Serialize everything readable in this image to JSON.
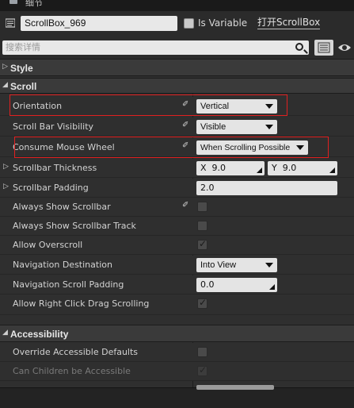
{
  "tab": {
    "title": "细节"
  },
  "header": {
    "name_value": "ScrollBox_969",
    "is_variable_label": "Is Variable",
    "open_label": "打开ScrollBox"
  },
  "search": {
    "placeholder": "搜索详情"
  },
  "categories": {
    "style": "Style",
    "scroll": "Scroll",
    "accessibility": "Accessibility"
  },
  "scroll": {
    "orientation": {
      "label": "Orientation",
      "value": "Vertical"
    },
    "scroll_bar_visibility": {
      "label": "Scroll Bar Visibility",
      "value": "Visible"
    },
    "consume_mouse_wheel": {
      "label": "Consume Mouse Wheel",
      "value": "When Scrolling Possible"
    },
    "scrollbar_thickness": {
      "label": "Scrollbar Thickness",
      "x_label": "X",
      "x_value": "9.0",
      "y_label": "Y",
      "y_value": "9.0"
    },
    "scrollbar_padding": {
      "label": "Scrollbar Padding",
      "value": "2.0"
    },
    "always_show_scrollbar": {
      "label": "Always Show Scrollbar",
      "checked": false
    },
    "always_show_scrollbar_track": {
      "label": "Always Show Scrollbar Track",
      "checked": false
    },
    "allow_overscroll": {
      "label": "Allow Overscroll",
      "checked": true
    },
    "navigation_destination": {
      "label": "Navigation Destination",
      "value": "Into View"
    },
    "navigation_scroll_padding": {
      "label": "Navigation Scroll Padding",
      "value": "0.0"
    },
    "allow_right_click_drag": {
      "label": "Allow Right Click Drag Scrolling",
      "checked": true
    }
  },
  "accessibility": {
    "override_defaults": {
      "label": "Override Accessible Defaults",
      "checked": false
    },
    "can_children_be_accessible": {
      "label": "Can Children be Accessible",
      "checked": true
    }
  },
  "colors": {
    "highlight": "#e02020",
    "panel": "#2f2f2f",
    "header": "#3a3a3a"
  },
  "icons": [
    "details-tab-icon",
    "widget-icon",
    "search-icon",
    "view-options-icon",
    "eye-icon",
    "binding-icon"
  ]
}
